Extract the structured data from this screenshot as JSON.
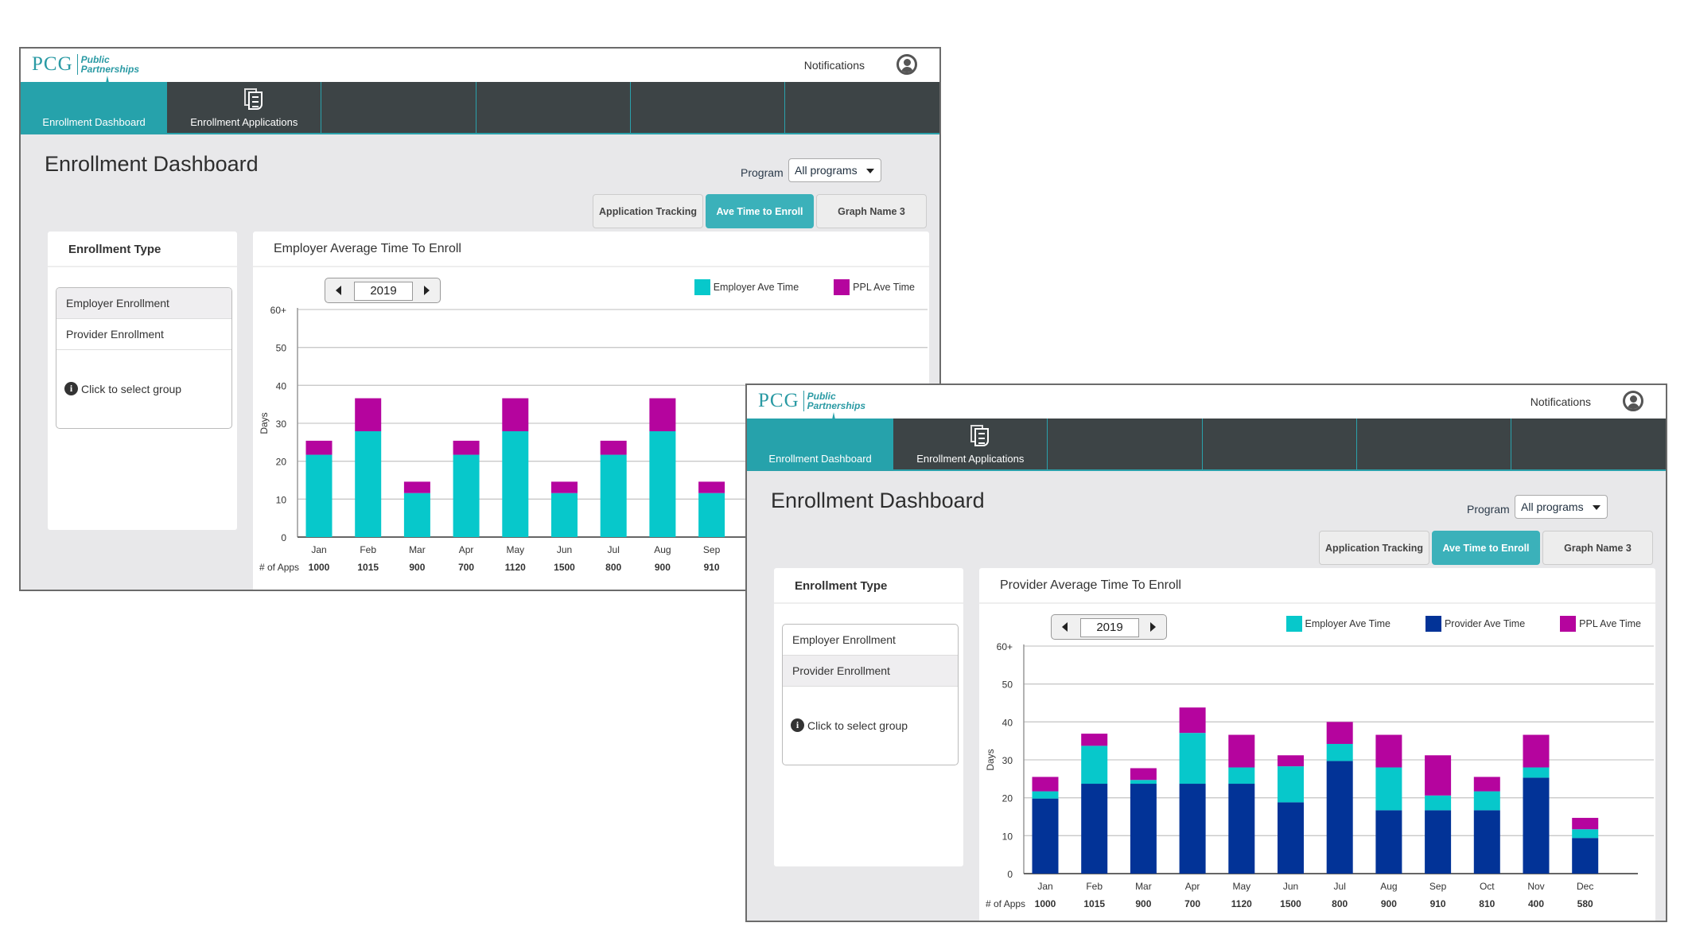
{
  "colors": {
    "teal_nav": "#26a2ab",
    "nav_dark": "#3d4446",
    "active_tab": "#3bb1ba",
    "employer": "#07c8cb",
    "provider": "#023397",
    "ppl": "#b5049e"
  },
  "windows": [
    {
      "logo": {
        "mark": "PCG",
        "line1": "Public",
        "line2": "Partnerships"
      },
      "header": {
        "notifications": "Notifications",
        "user_icon": "user-avatar-icon"
      },
      "nav": [
        {
          "label": "Enrollment Dashboard",
          "icon": "gauge-icon",
          "active": true
        },
        {
          "label": "Enrollment Applications",
          "icon": "documents-icon",
          "active": false
        }
      ],
      "page_title": "Enrollment Dashboard",
      "program": {
        "label": "Program",
        "value": "All programs"
      },
      "graph_tabs": [
        {
          "label": "Application Tracking",
          "active": false
        },
        {
          "label": "Ave Time to Enroll",
          "active": true
        },
        {
          "label": "Graph Name 3",
          "active": false
        }
      ],
      "sidebar": {
        "title": "Enrollment Type",
        "items": [
          {
            "label": "Employer Enrollment",
            "selected": true
          },
          {
            "label": "Provider Enrollment",
            "selected": false
          }
        ],
        "hint": "Click to select group"
      },
      "chart_card": {
        "title": "Employer Average Time To Enroll",
        "year": "2019"
      }
    },
    {
      "logo": {
        "mark": "PCG",
        "line1": "Public",
        "line2": "Partnerships"
      },
      "header": {
        "notifications": "Notifications",
        "user_icon": "user-avatar-icon"
      },
      "nav": [
        {
          "label": "Enrollment Dashboard",
          "icon": "gauge-icon",
          "active": true
        },
        {
          "label": "Enrollment Applications",
          "icon": "documents-icon",
          "active": false
        }
      ],
      "page_title": "Enrollment Dashboard",
      "program": {
        "label": "Program",
        "value": "All programs"
      },
      "graph_tabs": [
        {
          "label": "Application Tracking",
          "active": false
        },
        {
          "label": "Ave Time to Enroll",
          "active": true
        },
        {
          "label": "Graph Name 3",
          "active": false
        }
      ],
      "sidebar": {
        "title": "Enrollment Type",
        "items": [
          {
            "label": "Employer Enrollment",
            "selected": false
          },
          {
            "label": "Provider Enrollment",
            "selected": true
          }
        ],
        "hint": "Click to select group"
      },
      "chart_card": {
        "title": "Provider Average Time To Enroll",
        "year": "2019"
      }
    }
  ],
  "chart_data": [
    {
      "type": "bar",
      "stacked": true,
      "title": "Employer Average Time To Enroll",
      "xlabel": "",
      "ylabel": "Days",
      "ylim": [
        0,
        60
      ],
      "yticks": [
        "0",
        "10",
        "20",
        "30",
        "40",
        "50",
        "60+"
      ],
      "grid": true,
      "legend_position": "top-right",
      "categories": [
        "Jan",
        "Feb",
        "Mar",
        "Apr",
        "May",
        "Jun",
        "Jul",
        "Aug",
        "Sep"
      ],
      "apps_label": "# of Apps",
      "apps": [
        1000,
        1015,
        900,
        700,
        1120,
        1500,
        800,
        900,
        910
      ],
      "series": [
        {
          "name": "Employer Ave Time",
          "color": "#07c8cb",
          "values": [
            21.7,
            27.9,
            11.6,
            21.7,
            27.9,
            11.6,
            21.7,
            27.9,
            11.6
          ]
        },
        {
          "name": "PPL Ave Time",
          "color": "#b5049e",
          "values": [
            3.7,
            8.7,
            3.0,
            3.7,
            8.7,
            3.0,
            3.7,
            8.7,
            3.0
          ]
        }
      ]
    },
    {
      "type": "bar",
      "stacked": true,
      "title": "Provider Average Time To Enroll",
      "xlabel": "",
      "ylabel": "Days",
      "ylim": [
        0,
        60
      ],
      "yticks": [
        "0",
        "10",
        "20",
        "30",
        "40",
        "50",
        "60+"
      ],
      "grid": true,
      "legend_position": "top-right",
      "categories": [
        "Jan",
        "Feb",
        "Mar",
        "Apr",
        "May",
        "Jun",
        "Jul",
        "Aug",
        "Sep",
        "Oct",
        "Nov",
        "Dec"
      ],
      "apps_label": "# of Apps",
      "apps": [
        1000,
        1015,
        900,
        700,
        1120,
        1500,
        800,
        900,
        910,
        810,
        400,
        580
      ],
      "series": [
        {
          "name": "Provider Ave Time",
          "color": "#023397",
          "values": [
            19.8,
            23.7,
            23.7,
            23.7,
            23.7,
            18.8,
            29.7,
            16.7,
            16.7,
            16.7,
            25.3,
            9.4
          ]
        },
        {
          "name": "Employer Ave Time",
          "color": "#07c8cb",
          "values": [
            1.9,
            10.0,
            1.0,
            13.4,
            4.3,
            9.5,
            4.5,
            11.3,
            3.9,
            5.0,
            2.7,
            2.3
          ]
        },
        {
          "name": "PPL Ave Time",
          "color": "#b5049e",
          "values": [
            3.8,
            3.2,
            3.1,
            6.7,
            8.6,
            2.9,
            5.8,
            8.6,
            10.6,
            3.8,
            8.6,
            3.0
          ]
        }
      ],
      "legend_order": [
        "Employer Ave Time",
        "Provider Ave Time",
        "PPL Ave Time"
      ]
    }
  ]
}
